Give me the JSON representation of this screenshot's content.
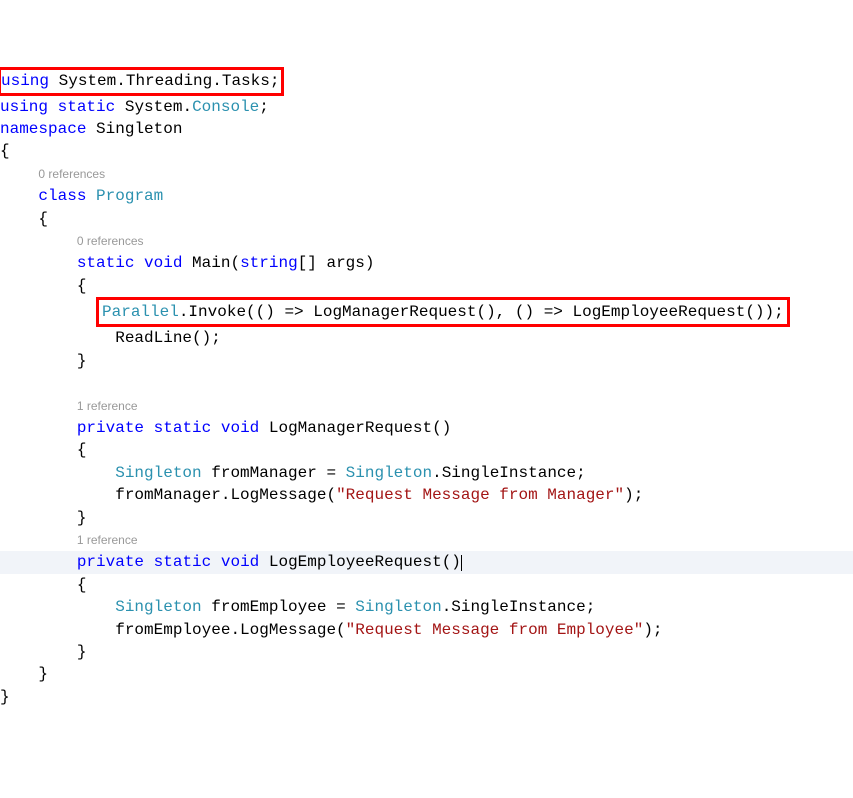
{
  "code": {
    "line1_using": "using",
    "line1_ns": "System.Threading.Tasks;",
    "line2_using": "using",
    "line2_static": "static",
    "line2_sys": "System.",
    "line2_console": "Console",
    "line2_semi": ";",
    "line3_namespace": "namespace",
    "line3_name": "Singleton",
    "obr": "{",
    "cbr": "}",
    "ref0": "0 references",
    "ref1": "1 reference",
    "class_kw": "class",
    "class_name": "Program",
    "static_kw": "static",
    "void_kw": "void",
    "private_kw": "private",
    "main_name": "Main",
    "main_paren_open": "(",
    "string_kw": "string",
    "brackets": "[]",
    "args": " args)",
    "parallel": "Parallel",
    "invoke": ".Invoke(() => LogManagerRequest(), () => LogEmployeeRequest());",
    "readline": "ReadLine();",
    "logmgr": "LogManagerRequest()",
    "logemp": "LogEmployeeRequest()",
    "singleton_type": "Singleton",
    "frommgr_decl": " fromManager = ",
    "single_inst": ".SingleInstance;",
    "frommgr_call1": "fromManager.LogMessage(",
    "str_mgr": "\"Request Message from Manager\"",
    "call_end": ");",
    "fromemp_decl": " fromEmployee = ",
    "fromemp_call1": "fromEmployee.LogMessage(",
    "str_emp": "\"Request Message from Employee\""
  }
}
